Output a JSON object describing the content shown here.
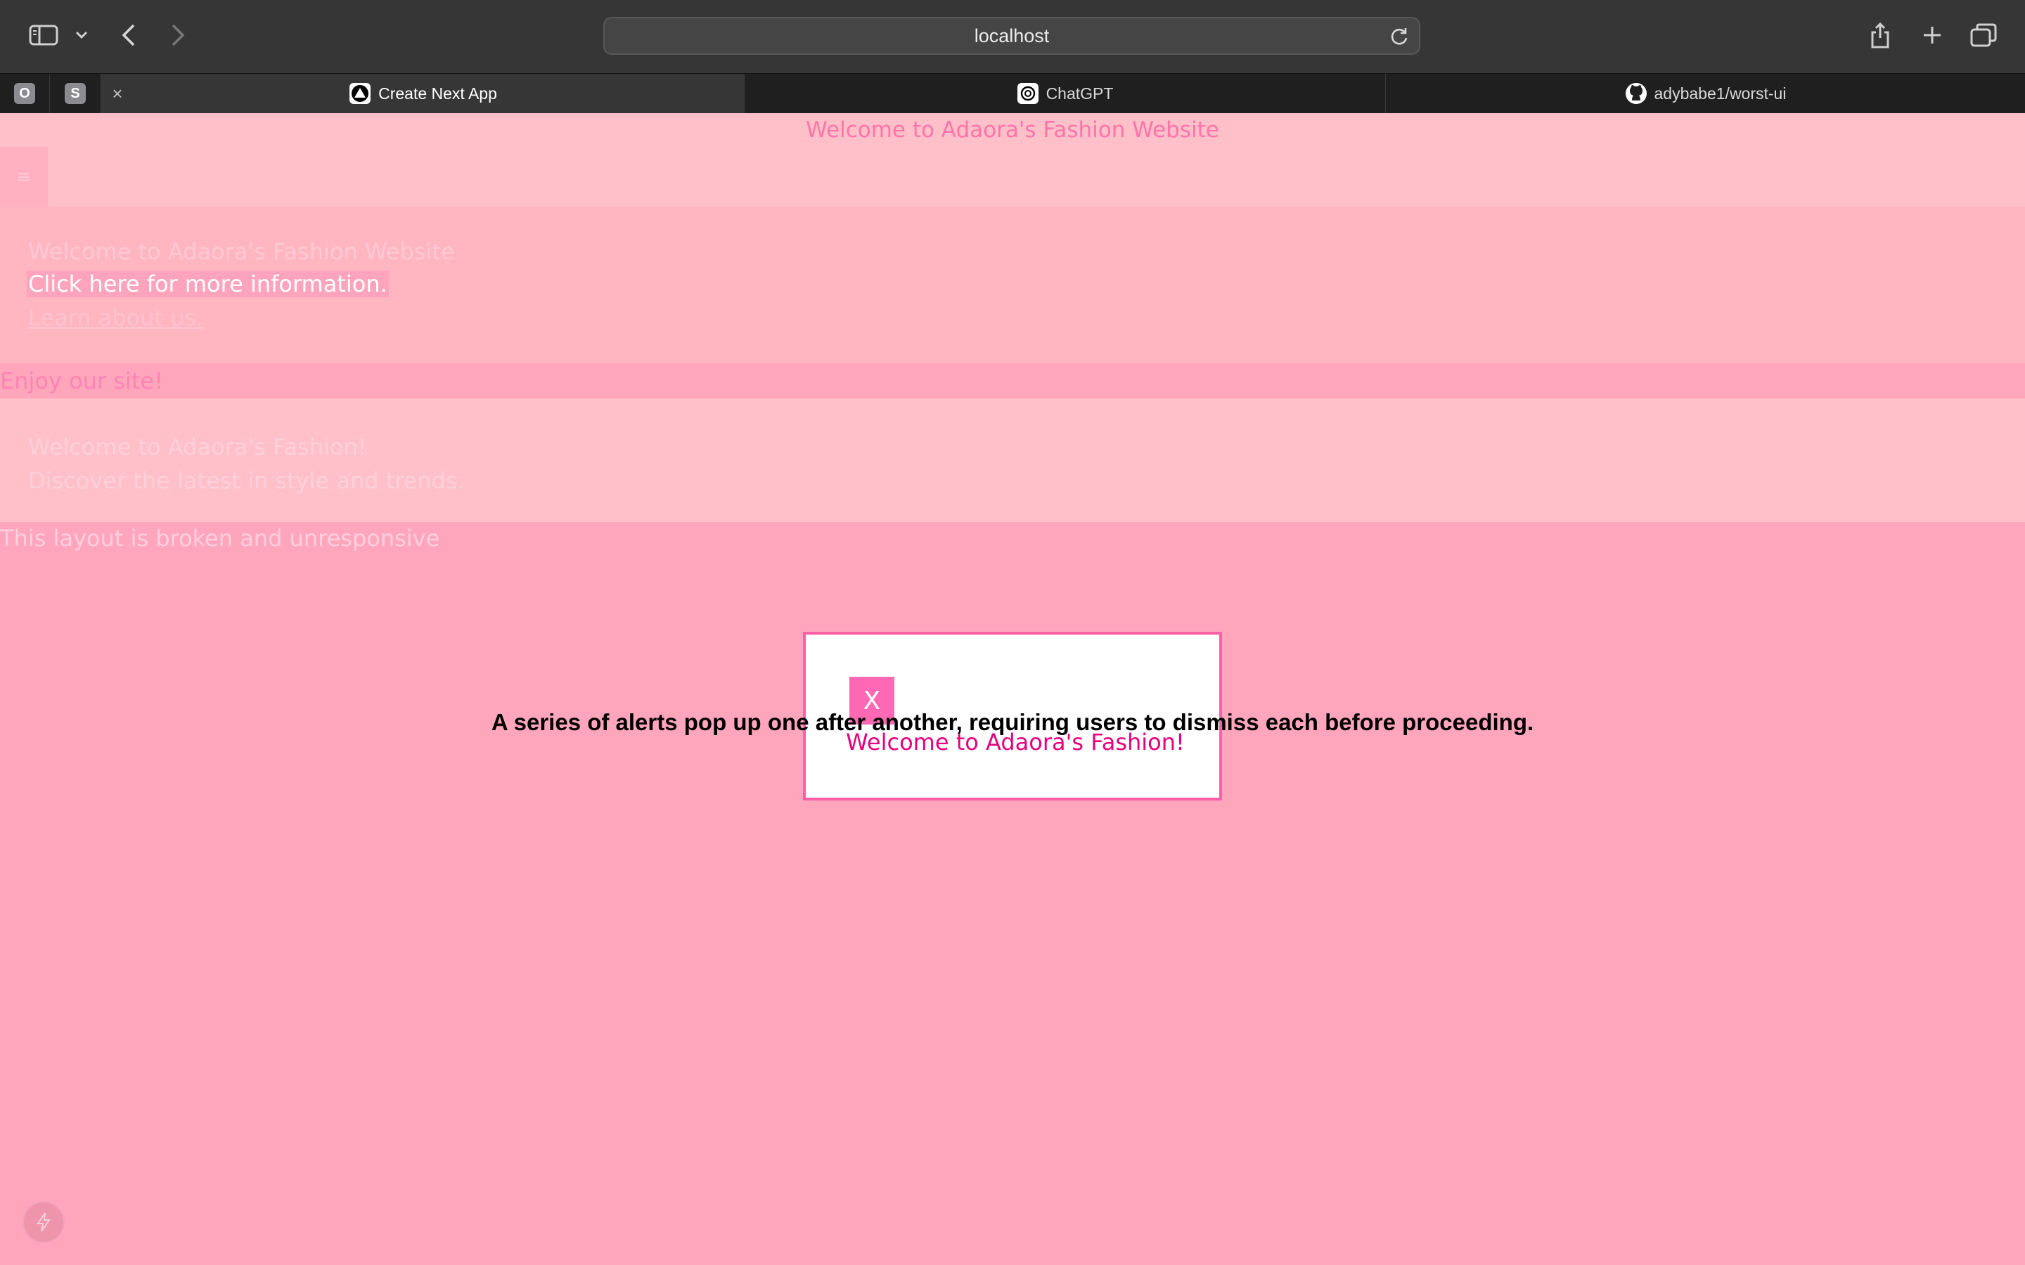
{
  "browser": {
    "url": "localhost",
    "icons": {
      "sidebar": "sidebar-toggle-icon",
      "dropdown": "chevron-down-icon",
      "back": "back-arrow-icon",
      "forward": "forward-arrow-icon",
      "reload": "reload-icon",
      "share": "share-icon",
      "new_tab": "plus-icon",
      "tab_overview": "tab-overview-icon"
    },
    "pinned_tabs": [
      "O",
      "S"
    ],
    "tabs": [
      {
        "title": "Create Next App",
        "active": true
      },
      {
        "title": "ChatGPT",
        "active": false
      },
      {
        "title": "adybabe1/worst-ui",
        "active": false
      }
    ]
  },
  "page": {
    "header_title": "Welcome to Adaora's Fashion Website",
    "menu_icon": "≡",
    "hero": {
      "heading": "Welcome to Adaora's Fashion Website",
      "link_more": "Click here for more information.",
      "link_about": "Learn about us."
    },
    "enjoy_text": "Enjoy our site!",
    "band": {
      "line1": "Welcome to Adaora's Fashion!",
      "line2": "Discover the latest in style and trends."
    },
    "broken_text": "This layout is broken and unresponsive"
  },
  "modal": {
    "close_label": "X",
    "message": "Welcome to Adaora's Fashion!"
  },
  "caption": "A series of alerts pop up one after another, requiring users to dismiss each before proceeding.",
  "colors": {
    "page_bg": "#ffa6bd",
    "accent": "#ff69b4",
    "modal_text": "#e6007e",
    "chrome_bg": "#363636"
  }
}
